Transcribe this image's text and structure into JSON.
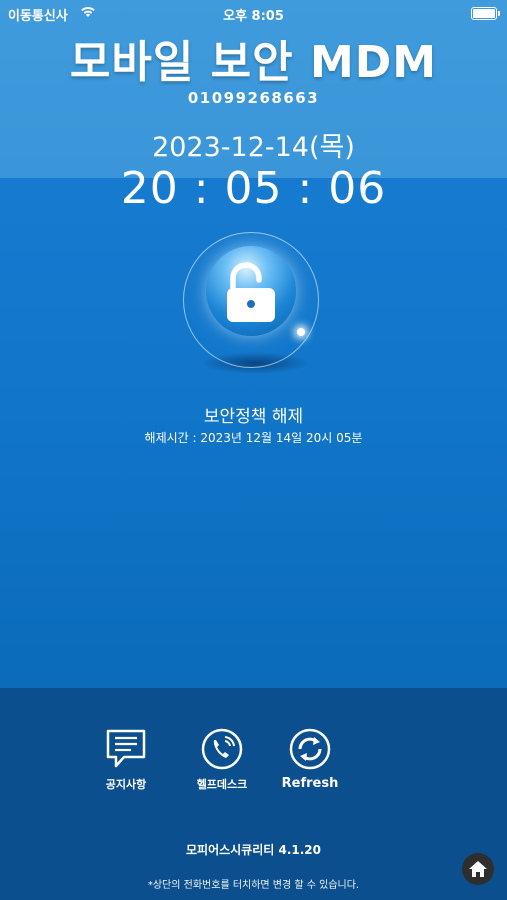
{
  "status_bar": {
    "carrier": "이동통신사",
    "time": "오후 8:05"
  },
  "header": {
    "title": "모바일 보안 MDM",
    "phone_number": "01099268663",
    "date": "2023-12-14(목)",
    "clock": "20 : 05 : 06"
  },
  "status": {
    "lock_state_icon": "unlocked-padlock-icon",
    "policy_title": "보안정책 해제",
    "release_time": "해제시간 : 2023년 12월 14일 20시 05분"
  },
  "actions": [
    {
      "label": "공지사항",
      "icon": "notice-message-icon"
    },
    {
      "label": "헬프데스크",
      "icon": "phone-icon"
    },
    {
      "label": "Refresh",
      "icon": "refresh-icon"
    }
  ],
  "footer": {
    "version": "모피어스시큐리티 4.1.20",
    "note": "*상단의 전화번호를 터치하면 변경 할 수 있습니다."
  },
  "colors": {
    "background": "#1277cb",
    "top_band": "#3a96d8",
    "bottom_panel": "#0b4f8e"
  }
}
